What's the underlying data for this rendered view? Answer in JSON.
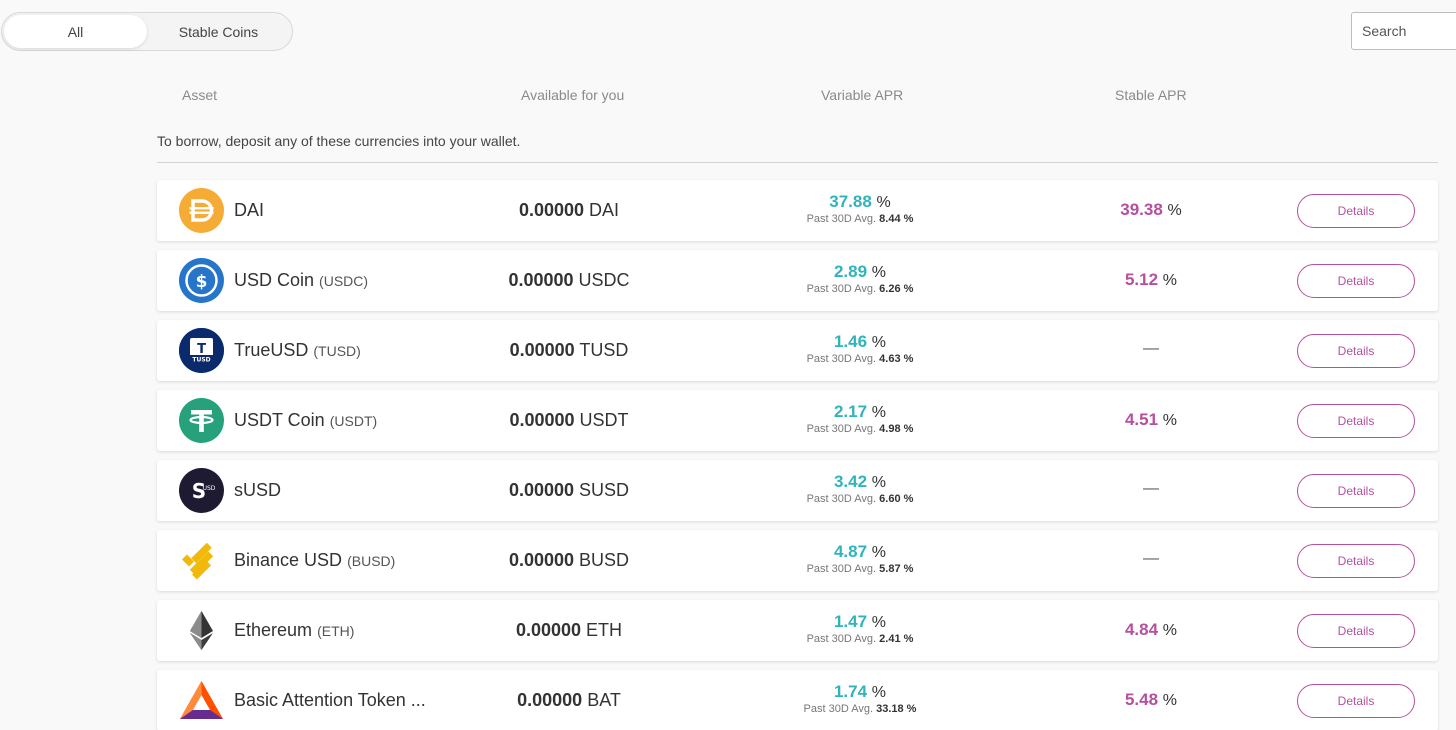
{
  "filter": {
    "tabs": [
      {
        "label": "All",
        "active": true
      },
      {
        "label": "Stable Coins",
        "active": false
      }
    ]
  },
  "search": {
    "placeholder": "Search"
  },
  "columns": {
    "asset": "Asset",
    "available": "Available for you",
    "variable_apr": "Variable APR",
    "stable_apr": "Stable APR"
  },
  "notice": "To borrow, deposit any of these currencies into your wallet.",
  "colors": {
    "accent_teal": "#2fb4bd",
    "accent_magenta": "#b6509e"
  },
  "assets": [
    {
      "icon": "dai-icon",
      "name": "DAI",
      "symbol": "",
      "available_amount": "0.00000",
      "available_unit": "DAI",
      "variable_apr": "37.88",
      "variable_30d_label": "Past 30D Avg.",
      "variable_30d": "8.44",
      "stable_apr": "39.38",
      "details_label": "Details"
    },
    {
      "icon": "usdc-icon",
      "name": "USD Coin",
      "symbol": "(USDC)",
      "available_amount": "0.00000",
      "available_unit": "USDC",
      "variable_apr": "2.89",
      "variable_30d_label": "Past 30D Avg.",
      "variable_30d": "6.26",
      "stable_apr": "5.12",
      "details_label": "Details"
    },
    {
      "icon": "tusd-icon",
      "name": "TrueUSD",
      "symbol": "(TUSD)",
      "available_amount": "0.00000",
      "available_unit": "TUSD",
      "variable_apr": "1.46",
      "variable_30d_label": "Past 30D Avg.",
      "variable_30d": "4.63",
      "stable_apr": "—",
      "details_label": "Details"
    },
    {
      "icon": "usdt-icon",
      "name": "USDT Coin",
      "symbol": "(USDT)",
      "available_amount": "0.00000",
      "available_unit": "USDT",
      "variable_apr": "2.17",
      "variable_30d_label": "Past 30D Avg.",
      "variable_30d": "4.98",
      "stable_apr": "4.51",
      "details_label": "Details"
    },
    {
      "icon": "susd-icon",
      "name": "sUSD",
      "symbol": "",
      "available_amount": "0.00000",
      "available_unit": "SUSD",
      "variable_apr": "3.42",
      "variable_30d_label": "Past 30D Avg.",
      "variable_30d": "6.60",
      "stable_apr": "—",
      "details_label": "Details"
    },
    {
      "icon": "busd-icon",
      "name": "Binance USD",
      "symbol": "(BUSD)",
      "available_amount": "0.00000",
      "available_unit": "BUSD",
      "variable_apr": "4.87",
      "variable_30d_label": "Past 30D Avg.",
      "variable_30d": "5.87",
      "stable_apr": "—",
      "details_label": "Details"
    },
    {
      "icon": "eth-icon",
      "name": "Ethereum",
      "symbol": "(ETH)",
      "available_amount": "0.00000",
      "available_unit": "ETH",
      "variable_apr": "1.47",
      "variable_30d_label": "Past 30D Avg.",
      "variable_30d": "2.41",
      "stable_apr": "4.84",
      "details_label": "Details"
    },
    {
      "icon": "bat-icon",
      "name": "Basic Attention Token ...",
      "symbol": "",
      "available_amount": "0.00000",
      "available_unit": "BAT",
      "variable_apr": "1.74",
      "variable_30d_label": "Past 30D Avg.",
      "variable_30d": "33.18",
      "stable_apr": "5.48",
      "details_label": "Details"
    }
  ]
}
